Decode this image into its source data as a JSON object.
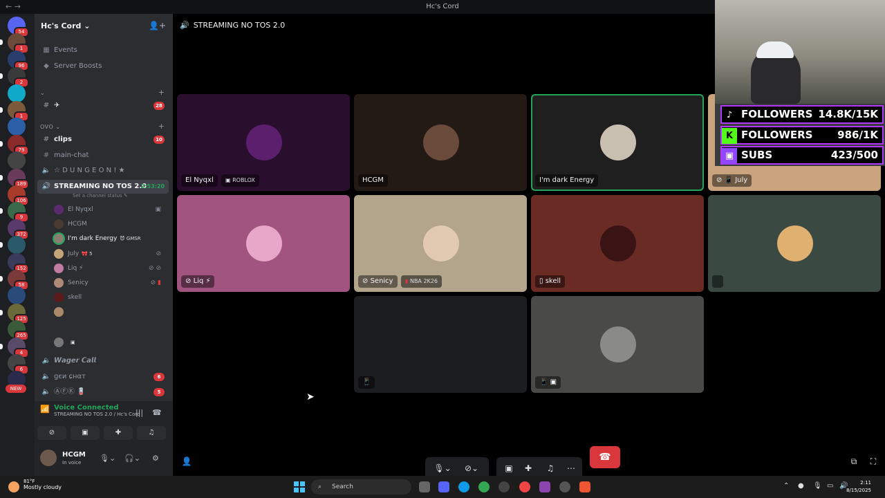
{
  "window": {
    "title": "Hc's Cord"
  },
  "server": {
    "name": "Hc's Cord",
    "rail_badges": [
      "54",
      "1",
      "96",
      "2",
      "",
      "1",
      "",
      "79",
      "",
      "189",
      "106",
      "9",
      "372",
      "",
      "152",
      "58",
      "",
      "125",
      "265",
      "4",
      "6",
      ""
    ],
    "new_label": "NEW"
  },
  "sidebar": {
    "events": "Events",
    "boosts": "Server Boosts",
    "cat1": "⌄",
    "ch_plane": "✈",
    "ch_plane_badge": "28",
    "cat_ovo": "OVO ⌄",
    "clips": "clips",
    "clips_badge": "10",
    "main_chat": "main-chat",
    "dungeon": "☆ D U N G E O N ! ★",
    "streaming": "STREAMING NO TOS 2.0",
    "streaming_timer": "2:53:20",
    "channel_status": "Set a channel status ✎",
    "voice_users": [
      {
        "name": "El Nyqxl",
        "tag": ""
      },
      {
        "name": "HCGM",
        "tag": ""
      },
      {
        "name": "I'm dark Energy",
        "tag": "😈 GMSR"
      },
      {
        "name": "July",
        "tag": "🎀 5"
      },
      {
        "name": "Liq ⚡",
        "tag": ""
      },
      {
        "name": "Senicy",
        "tag": ""
      },
      {
        "name": "skell",
        "tag": ""
      }
    ],
    "wager_call": "𝙒𝙖𝙜𝙚𝙧 𝘾𝙖𝙡𝙡",
    "gen_chat": "ɡєи ɕнαт",
    "gen_chat_badge": "6",
    "afk": "ⒶⒻⓀ 🪫",
    "afk_badge": "5"
  },
  "voice_panel": {
    "status": "Voice Connected",
    "channel": "STREAMING NO TOS 2.0 / Hc's Cord"
  },
  "user": {
    "name": "HCGM",
    "status": "In voice"
  },
  "stage": {
    "channel_name": "STREAMING NO TOS 2.0",
    "tiles": [
      {
        "name": "El Nyqxl",
        "activity": "ROBLOX"
      },
      {
        "name": "HCGM",
        "activity": ""
      },
      {
        "name": "I'm dark Energy",
        "activity": ""
      },
      {
        "name": "📱 July",
        "activity": ""
      },
      {
        "name": "Liq ⚡",
        "activity": ""
      },
      {
        "name": "Senicy",
        "activity": "NBA 2K26"
      },
      {
        "name": "skell",
        "activity": ""
      },
      {
        "name": "",
        "activity": ""
      },
      {
        "name": "📱",
        "activity": ""
      },
      {
        "name": "📱 ▣",
        "activity": ""
      }
    ]
  },
  "overlay": {
    "stats": [
      {
        "icon": "♪",
        "label": "FOLLOWERS",
        "value": "14.8K/15K"
      },
      {
        "icon": "K",
        "label": "FOLLOWERS",
        "value": "986/1K"
      },
      {
        "icon": "▣",
        "label": "SUBS",
        "value": "423/500"
      }
    ]
  },
  "taskbar": {
    "temp": "81°F",
    "weather": "Mostly cloudy",
    "search": "Search",
    "time": "2:11",
    "date": "8/15/2025"
  }
}
